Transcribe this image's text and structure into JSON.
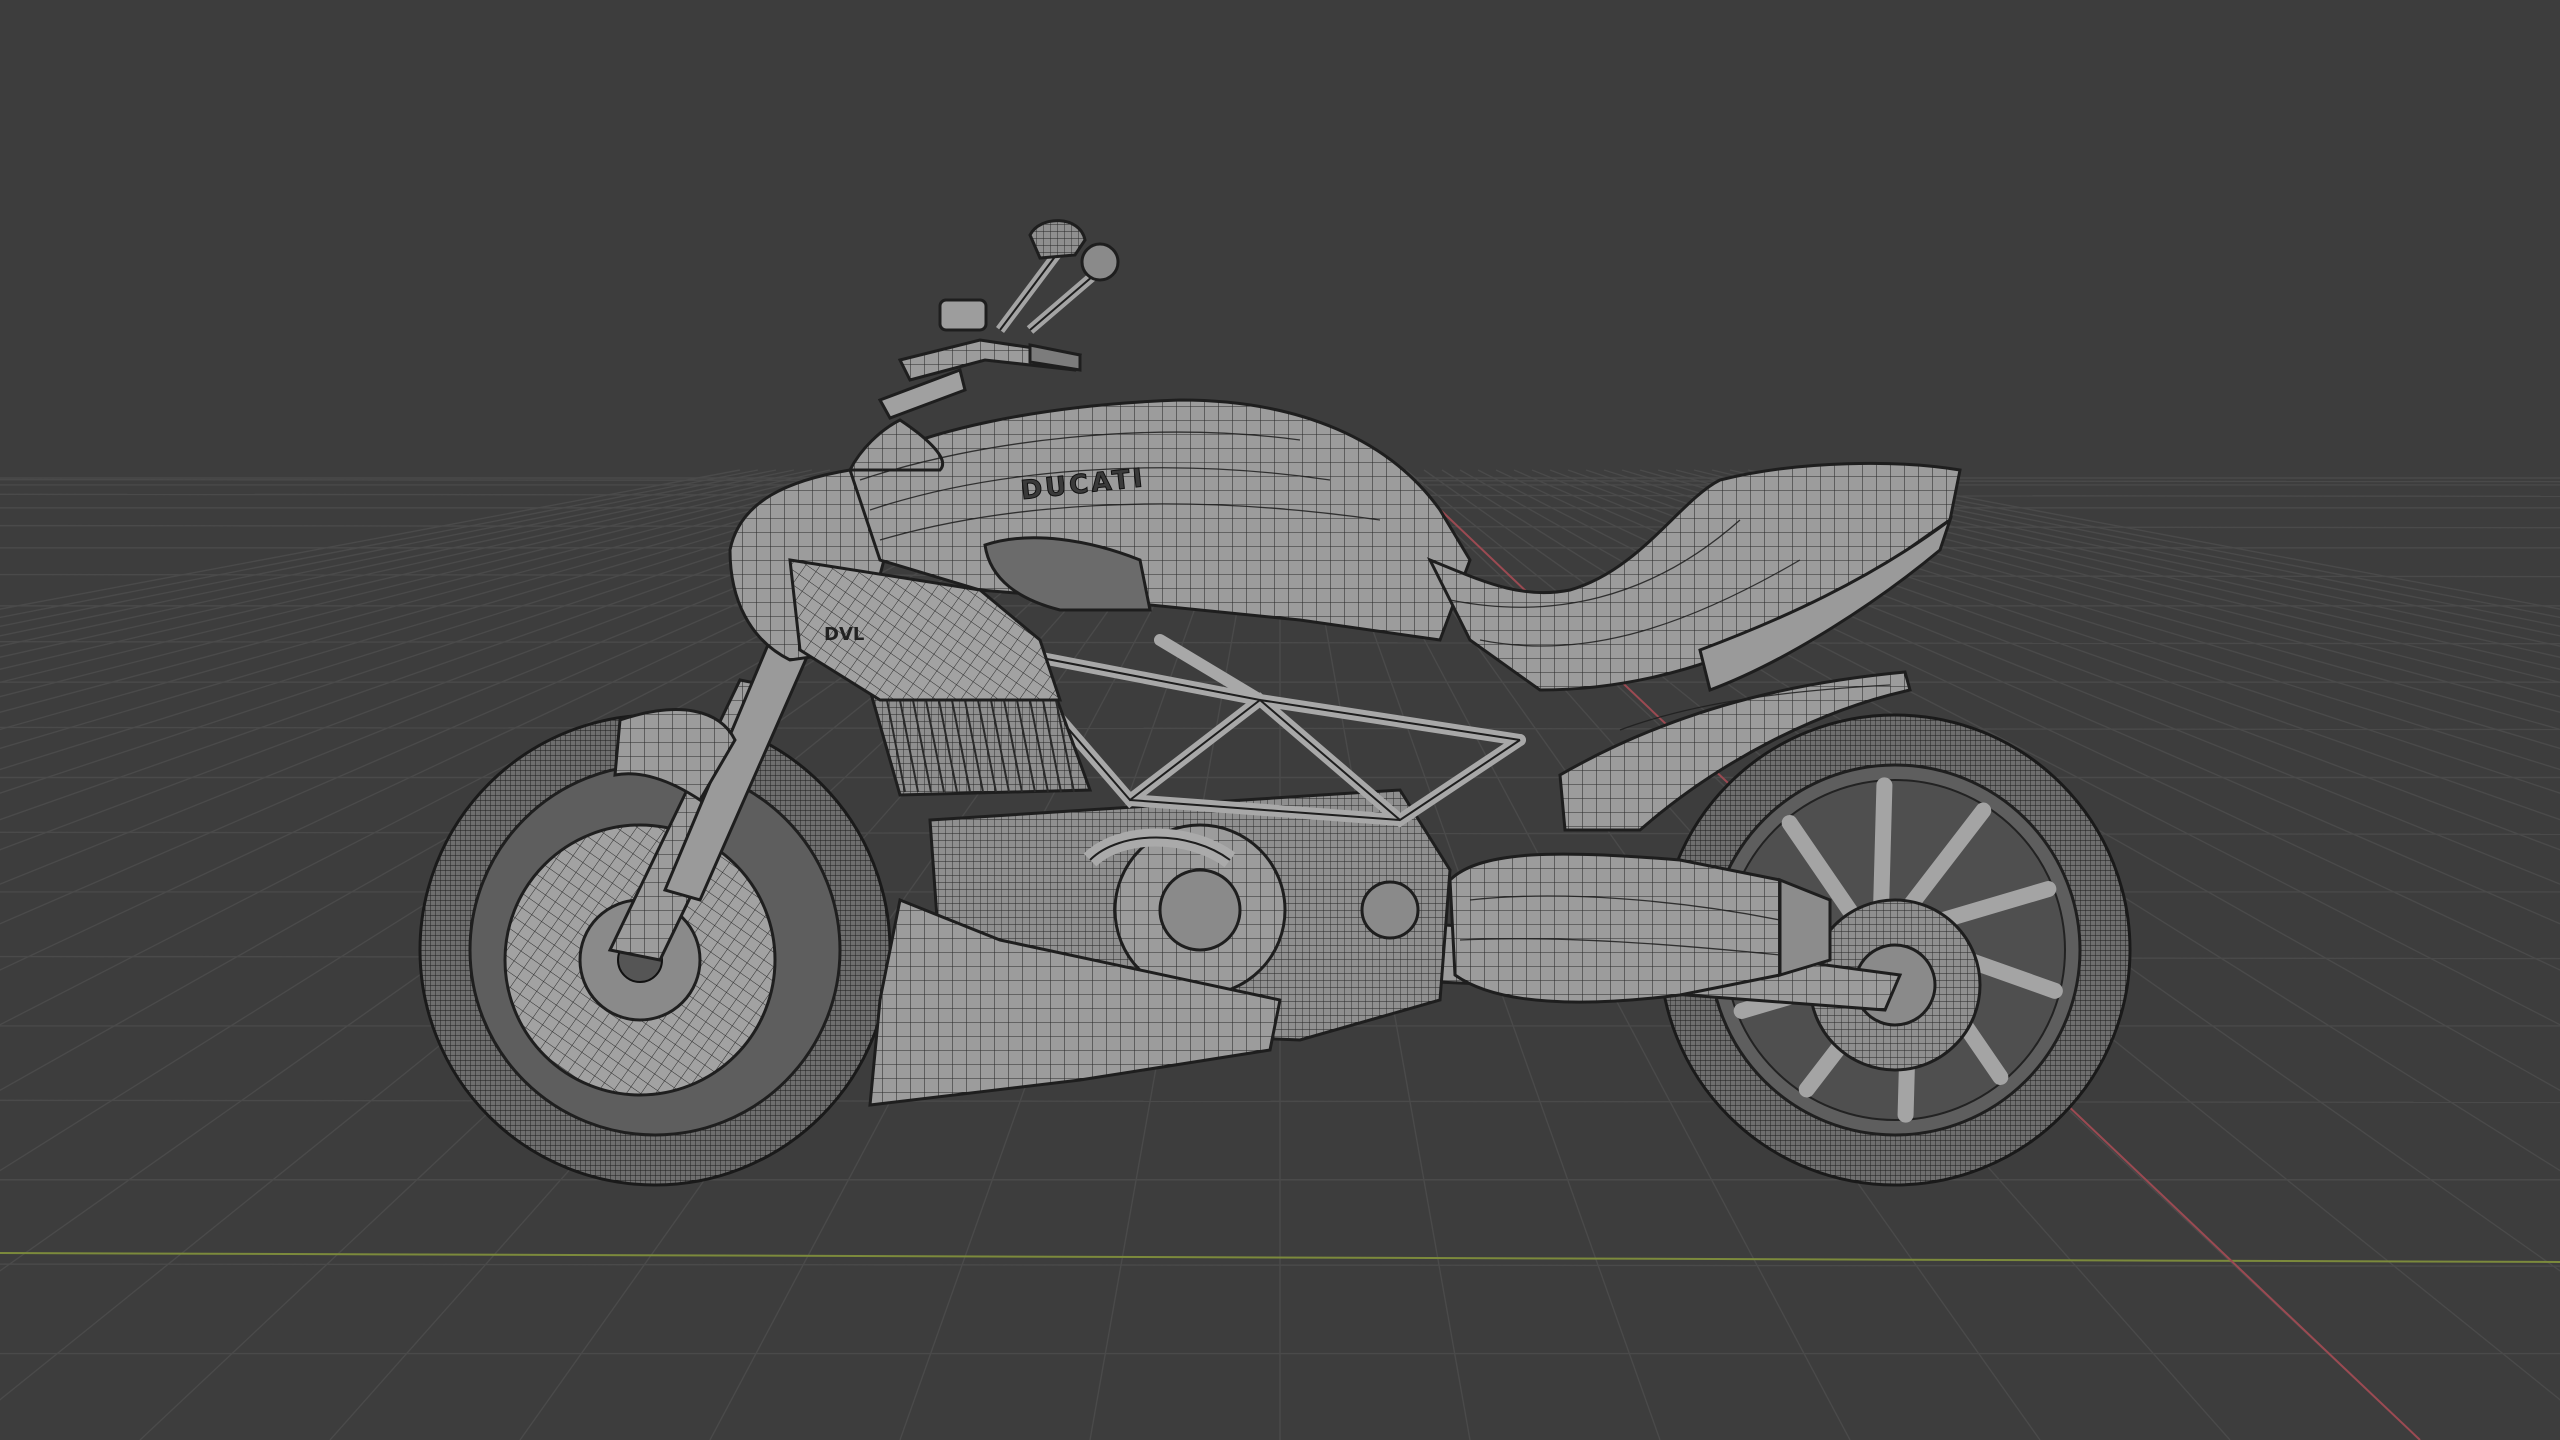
{
  "viewport": {
    "background_color": "#3d3d3d",
    "grid_color": "#4a4a4a",
    "x_axis_color": "#9b4a52",
    "y_axis_color": "#7c8a3c",
    "shading": "wireframe"
  },
  "model": {
    "tank_text": "DUCATI",
    "side_badge_text": "DVL",
    "body_color": "#9a9a9a",
    "edge_color": "#1e1e1e"
  }
}
